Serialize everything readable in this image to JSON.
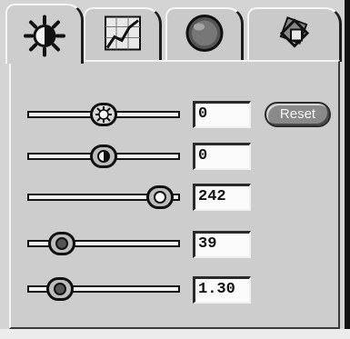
{
  "tabs": [
    {
      "name": "brightness",
      "icon": "brightness-sun-icon",
      "active": true
    },
    {
      "name": "curve",
      "icon": "curve-graph-icon",
      "active": false
    },
    {
      "name": "color",
      "icon": "color-sphere-icon",
      "active": false
    },
    {
      "name": "transform",
      "icon": "transform-shapes-icon",
      "active": false
    }
  ],
  "reset_label": "Reset",
  "sliders": [
    {
      "value": "0",
      "thumb_icon": "sun-icon"
    },
    {
      "value": "0",
      "thumb_icon": "half-circle-contrast-icon"
    },
    {
      "value": "242",
      "thumb_icon": "white-circle-icon"
    },
    {
      "value": "39",
      "thumb_icon": "dark-circle-icon"
    },
    {
      "value": "1.30",
      "thumb_icon": "dark-circle-icon"
    }
  ],
  "colors": {
    "panel": "#cdcdcd",
    "track": "#f2f2f2",
    "border": "#141414",
    "button": "#8a8a8a"
  }
}
